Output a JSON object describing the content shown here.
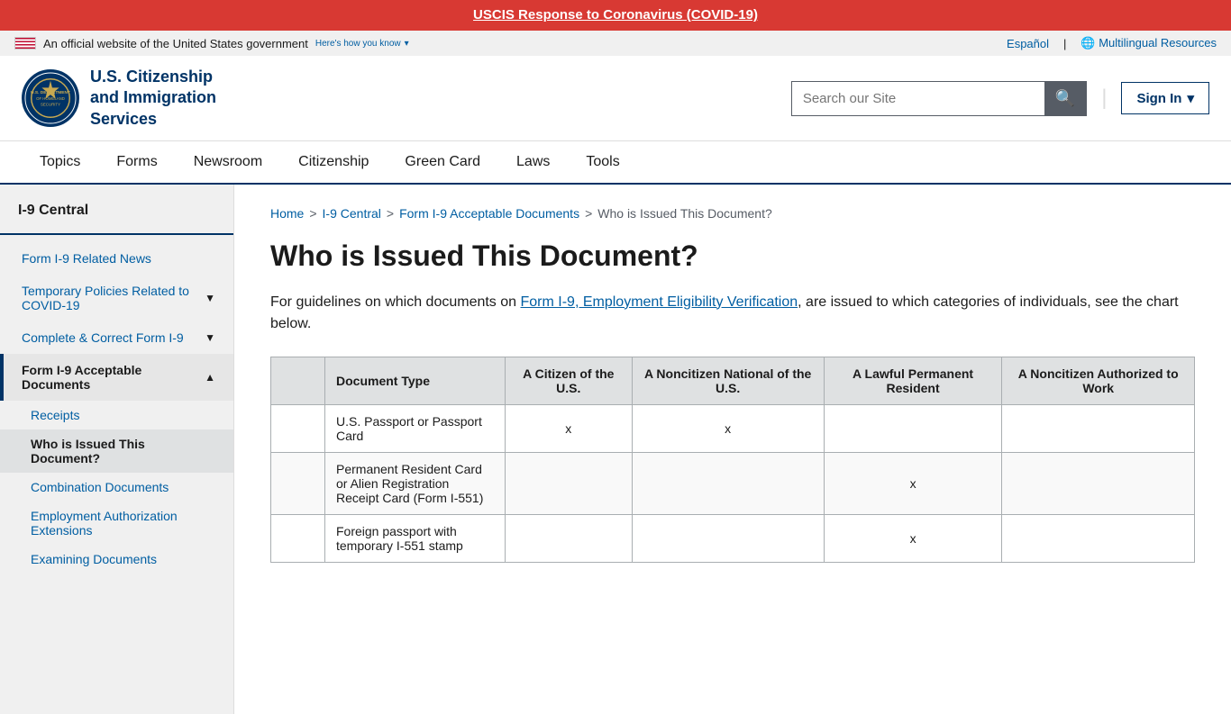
{
  "covid_banner": {
    "link_text": "USCIS Response to Coronavirus (COVID-19)",
    "link_href": "#"
  },
  "gov_bar": {
    "official_text": "An official website of the United States government",
    "how_know_label": "Here's how you know",
    "espanol_label": "Español",
    "multilingual_label": "Multilingual Resources"
  },
  "header": {
    "logo_text_line1": "U.S. Citizenship",
    "logo_text_line2": "and Immigration",
    "logo_text_line3": "Services",
    "search_placeholder": "Search our Site",
    "search_label": "Search our Site",
    "sign_in_label": "Sign In"
  },
  "nav": {
    "items": [
      {
        "label": "Topics",
        "href": "#"
      },
      {
        "label": "Forms",
        "href": "#"
      },
      {
        "label": "Newsroom",
        "href": "#"
      },
      {
        "label": "Citizenship",
        "href": "#"
      },
      {
        "label": "Green Card",
        "href": "#"
      },
      {
        "label": "Laws",
        "href": "#"
      },
      {
        "label": "Tools",
        "href": "#"
      }
    ]
  },
  "sidebar": {
    "title": "I-9 Central",
    "items": [
      {
        "label": "Form I-9 Related News",
        "type": "link",
        "active": false
      },
      {
        "label": "Temporary Policies Related to COVID-19",
        "type": "expandable",
        "active": false
      },
      {
        "label": "Complete & Correct Form I-9",
        "type": "expandable",
        "active": false
      },
      {
        "label": "Form I-9 Acceptable Documents",
        "type": "expandable",
        "active": true,
        "expanded": true,
        "children": [
          {
            "label": "Receipts",
            "active": false
          },
          {
            "label": "Who is Issued This Document?",
            "active": true
          },
          {
            "label": "Combination Documents",
            "active": false
          },
          {
            "label": "Employment Authorization Extensions",
            "active": false
          },
          {
            "label": "Examining Documents",
            "active": false
          }
        ]
      }
    ]
  },
  "breadcrumb": {
    "items": [
      {
        "label": "Home",
        "href": "#"
      },
      {
        "label": "I-9 Central",
        "href": "#"
      },
      {
        "label": "Form I-9 Acceptable Documents",
        "href": "#"
      },
      {
        "label": "Who is Issued This Document?",
        "href": null
      }
    ]
  },
  "page_title": "Who is Issued This Document?",
  "intro_text_before_link": "For guidelines on which documents on ",
  "intro_link_text": "Form I-9, Employment Eligibility Verification",
  "intro_text_after_link": ", are issued to which categories of individuals, see the chart below.",
  "table": {
    "columns": [
      "",
      "Document Type",
      "A Citizen of the U.S.",
      "A Noncitizen National of the U.S.",
      "A Lawful Permanent Resident",
      "A Noncitizen Authorized to Work"
    ],
    "rows": [
      {
        "num": "",
        "doc_type": "U.S. Passport or Passport Card",
        "citizen": "x",
        "noncitizen_national": "x",
        "lawful_permanent": "",
        "noncitizen_work": ""
      },
      {
        "num": "",
        "doc_type": "Permanent Resident Card or Alien Registration Receipt Card (Form I-551)",
        "citizen": "",
        "noncitizen_national": "",
        "lawful_permanent": "x",
        "noncitizen_work": ""
      },
      {
        "num": "",
        "doc_type": "Foreign passport with temporary I-551 stamp",
        "citizen": "",
        "noncitizen_national": "",
        "lawful_permanent": "x",
        "noncitizen_work": ""
      }
    ]
  }
}
